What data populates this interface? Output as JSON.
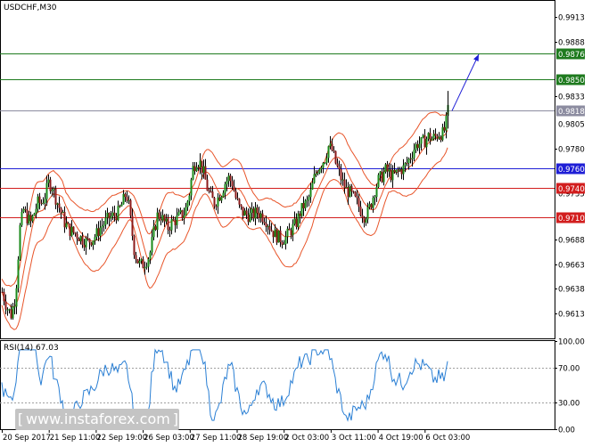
{
  "title": "USDCHF,M30",
  "chart_data": [
    {
      "type": "candlestick",
      "symbol": "USDCHF",
      "timeframe": "M30",
      "ylim": [
        0.9588,
        0.9929
      ],
      "y_ticks": [
        {
          "value": 0.9913,
          "label": "0.9913"
        },
        {
          "value": 0.9888,
          "label": "0.9888"
        },
        {
          "value": 0.9833,
          "label": "0.9833"
        },
        {
          "value": 0.978,
          "label": "0.9780"
        },
        {
          "value": 0.9688,
          "label": "0.9688"
        },
        {
          "value": 0.9663,
          "label": "0.9663"
        },
        {
          "value": 0.9638,
          "label": "0.9638"
        },
        {
          "value": 0.9613,
          "label": "0.9613"
        }
      ],
      "obscured_tick_fragments": [
        {
          "value": 0.9805,
          "label": "0.9805"
        },
        {
          "value": 0.9735,
          "label": "0.9735"
        },
        {
          "value": 0.971,
          "label": "0.9710"
        }
      ],
      "x_tick_labels": [
        "20 Sep 2017",
        "21 Sep 11:00",
        "22 Sep 19:00",
        "26 Sep 03:00",
        "27 Sep 11:00",
        "28 Sep 19:00",
        "2 Oct 03:00",
        "3 Oct 11:00",
        "4 Oct 19:00",
        "6 Oct 03:00"
      ],
      "levels": [
        {
          "value": 0.9876,
          "label": "0.9876",
          "color": "#1e7a1e",
          "role": "target"
        },
        {
          "value": 0.985,
          "label": "0.9850",
          "color": "#1e7a1e",
          "role": "target"
        },
        {
          "value": 0.9818,
          "label": "0.9818",
          "color": "#8c8ca0",
          "role": "current"
        },
        {
          "value": 0.976,
          "label": "0.9760",
          "color": "#1f1fd6",
          "role": "pivot"
        },
        {
          "value": 0.974,
          "label": "0.9740",
          "color": "#d21e1e",
          "role": "support"
        },
        {
          "value": 0.971,
          "label": "0.9710",
          "color": "#d21e1e",
          "role": "support"
        }
      ],
      "price_path": [
        [
          0,
          0.9635
        ],
        [
          5,
          0.962
        ],
        [
          10,
          0.9612
        ],
        [
          15,
          0.963
        ],
        [
          20,
          0.97
        ],
        [
          24,
          0.9718
        ],
        [
          28,
          0.971
        ],
        [
          32,
          0.9705
        ],
        [
          36,
          0.9715
        ],
        [
          40,
          0.9725
        ],
        [
          44,
          0.9725
        ],
        [
          48,
          0.9732
        ],
        [
          52,
          0.9745
        ],
        [
          56,
          0.9742
        ],
        [
          60,
          0.973
        ],
        [
          65,
          0.9718
        ],
        [
          70,
          0.9705
        ],
        [
          75,
          0.9698
        ],
        [
          80,
          0.9695
        ],
        [
          85,
          0.9692
        ],
        [
          90,
          0.9688
        ],
        [
          95,
          0.9685
        ],
        [
          100,
          0.9688
        ],
        [
          105,
          0.9692
        ],
        [
          110,
          0.97
        ],
        [
          115,
          0.9705
        ],
        [
          120,
          0.971
        ],
        [
          125,
          0.9712
        ],
        [
          130,
          0.9715
        ],
        [
          135,
          0.9725
        ],
        [
          139,
          0.9735
        ],
        [
          142,
          0.9722
        ],
        [
          145,
          0.97
        ],
        [
          148,
          0.9678
        ],
        [
          151,
          0.9668
        ],
        [
          154,
          0.9663
        ],
        [
          157,
          0.9662
        ],
        [
          160,
          0.9665
        ],
        [
          163,
          0.9668
        ],
        [
          166,
          0.9675
        ],
        [
          170,
          0.9695
        ],
        [
          174,
          0.9712
        ],
        [
          178,
          0.9712
        ],
        [
          182,
          0.9705
        ],
        [
          186,
          0.97
        ],
        [
          190,
          0.9705
        ],
        [
          195,
          0.9708
        ],
        [
          200,
          0.9712
        ],
        [
          205,
          0.9715
        ],
        [
          210,
          0.9735
        ],
        [
          214,
          0.976
        ],
        [
          218,
          0.9768
        ],
        [
          222,
          0.9765
        ],
        [
          226,
          0.9755
        ],
        [
          230,
          0.974
        ],
        [
          234,
          0.973
        ],
        [
          238,
          0.9725
        ],
        [
          242,
          0.973
        ],
        [
          246,
          0.9736
        ],
        [
          250,
          0.9745
        ],
        [
          254,
          0.975
        ],
        [
          258,
          0.9745
        ],
        [
          262,
          0.973
        ],
        [
          266,
          0.972
        ],
        [
          270,
          0.9715
        ],
        [
          274,
          0.9713
        ],
        [
          278,
          0.9712
        ],
        [
          282,
          0.9713
        ],
        [
          286,
          0.9716
        ],
        [
          290,
          0.9713
        ],
        [
          294,
          0.971
        ],
        [
          298,
          0.9705
        ],
        [
          302,
          0.9698
        ],
        [
          306,
          0.9693
        ],
        [
          310,
          0.969
        ],
        [
          314,
          0.9688
        ],
        [
          318,
          0.969
        ],
        [
          322,
          0.9695
        ],
        [
          326,
          0.97
        ],
        [
          330,
          0.9705
        ],
        [
          334,
          0.9715
        ],
        [
          338,
          0.9722
        ],
        [
          342,
          0.9725
        ],
        [
          346,
          0.9735
        ],
        [
          350,
          0.975
        ],
        [
          354,
          0.976
        ],
        [
          358,
          0.9765
        ],
        [
          362,
          0.977
        ],
        [
          366,
          0.9782
        ],
        [
          370,
          0.9778
        ],
        [
          374,
          0.9765
        ],
        [
          378,
          0.9755
        ],
        [
          382,
          0.9745
        ],
        [
          386,
          0.9738
        ],
        [
          390,
          0.9735
        ],
        [
          394,
          0.973
        ],
        [
          398,
          0.9725
        ],
        [
          402,
          0.9718
        ],
        [
          406,
          0.9712
        ],
        [
          410,
          0.9715
        ],
        [
          414,
          0.9725
        ],
        [
          418,
          0.9738
        ],
        [
          422,
          0.9748
        ],
        [
          426,
          0.9752
        ],
        [
          430,
          0.9758
        ],
        [
          434,
          0.9755
        ],
        [
          438,
          0.9752
        ],
        [
          442,
          0.9755
        ],
        [
          446,
          0.9758
        ],
        [
          450,
          0.976
        ],
        [
          454,
          0.9765
        ],
        [
          458,
          0.9772
        ],
        [
          462,
          0.978
        ],
        [
          466,
          0.9785
        ],
        [
          470,
          0.9785
        ],
        [
          474,
          0.9788
        ],
        [
          478,
          0.9792
        ],
        [
          482,
          0.979
        ],
        [
          486,
          0.9792
        ],
        [
          490,
          0.9795
        ],
        [
          494,
          0.9795
        ],
        [
          497,
          0.98
        ],
        [
          500,
          0.9818
        ]
      ],
      "bollinger_width": 0.0022,
      "forecast_arrow": {
        "from": [
          505,
          0.9818
        ],
        "to": [
          535,
          0.9875
        ],
        "color": "#1f1fd6"
      }
    },
    {
      "type": "line",
      "name": "RSI(14)",
      "label": "RSI(14) 67.03",
      "value": 67.03,
      "ylim": [
        0,
        100
      ],
      "y_ticks": [
        {
          "value": 100,
          "label": "100.00"
        },
        {
          "value": 70,
          "label": "70.00"
        },
        {
          "value": 30,
          "label": "30.00"
        },
        {
          "value": 0,
          "label": "0.00"
        }
      ],
      "guides": [
        70,
        30
      ],
      "color": "#2a7fd4"
    }
  ],
  "watermark": {
    "text": "www.instaforex.com",
    "left_bracket": "[",
    "right_bracket": "]"
  }
}
